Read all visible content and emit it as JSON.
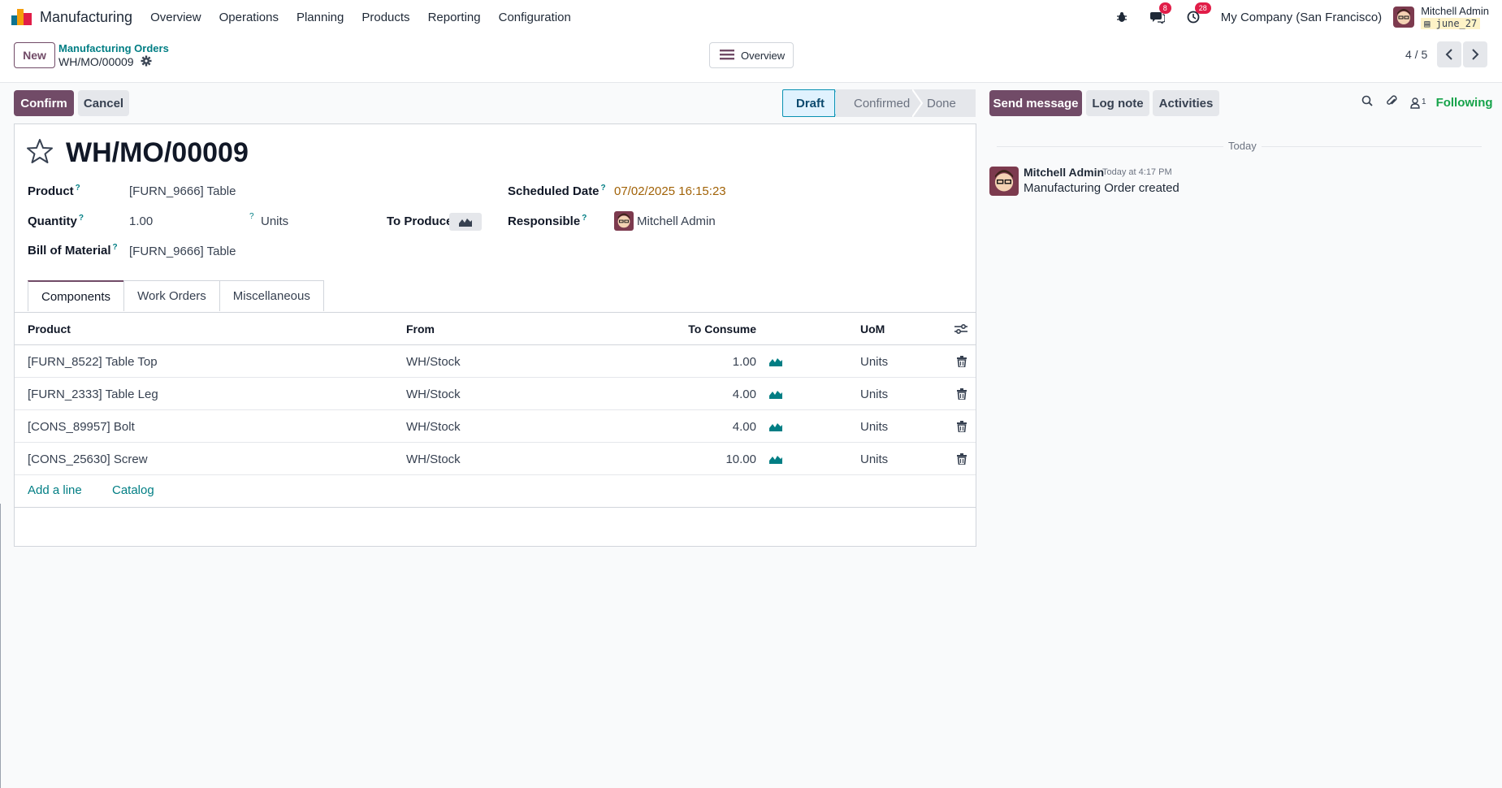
{
  "colors": {
    "primary": "#714b67",
    "link": "#017e84",
    "badge": "#e11d48",
    "following": "#16a34a"
  },
  "navbar": {
    "app_name": "Manufacturing",
    "menu": [
      "Overview",
      "Operations",
      "Planning",
      "Products",
      "Reporting",
      "Configuration"
    ],
    "icons": [
      "bug-icon",
      "chat-icon",
      "clock-icon"
    ],
    "messages_badge": "8",
    "activities_badge": "28",
    "company": "My Company (San Francisco)",
    "user_name": "Mitchell Admin",
    "database": "june_27"
  },
  "control": {
    "new_label": "New",
    "breadcrumb_parent": "Manufacturing Orders",
    "breadcrumb_current": "WH/MO/00009",
    "overview_label": "Overview",
    "pager": "4 / 5"
  },
  "actions": {
    "confirm": "Confirm",
    "cancel": "Cancel"
  },
  "status": {
    "stages": [
      "Draft",
      "Confirmed",
      "Done"
    ],
    "current": "Draft"
  },
  "form": {
    "title": "WH/MO/00009",
    "product_label": "Product",
    "product_value": "[FURN_9666] Table",
    "quantity_label": "Quantity",
    "quantity_value": "1.00",
    "uom_value": "Units",
    "to_produce_label": "To Produce",
    "bom_label": "Bill of Material",
    "bom_value": "[FURN_9666] Table",
    "scheduled_label": "Scheduled Date",
    "scheduled_value": "07/02/2025 16:15:23",
    "responsible_label": "Responsible",
    "responsible_value": "Mitchell Admin",
    "help_mark": "?"
  },
  "tabs": [
    "Components",
    "Work Orders",
    "Miscellaneous"
  ],
  "components": {
    "headers": {
      "product": "Product",
      "from": "From",
      "to_consume": "To Consume",
      "uom": "UoM"
    },
    "rows": [
      {
        "product": "[FURN_8522] Table Top",
        "from": "WH/Stock",
        "qty": "1.00",
        "uom": "Units"
      },
      {
        "product": "[FURN_2333] Table Leg",
        "from": "WH/Stock",
        "qty": "4.00",
        "uom": "Units"
      },
      {
        "product": "[CONS_89957] Bolt",
        "from": "WH/Stock",
        "qty": "4.00",
        "uom": "Units"
      },
      {
        "product": "[CONS_25630] Screw",
        "from": "WH/Stock",
        "qty": "10.00",
        "uom": "Units"
      }
    ],
    "add_line": "Add a line",
    "catalog": "Catalog"
  },
  "chatter": {
    "send_message": "Send message",
    "log_note": "Log note",
    "activities": "Activities",
    "followers_count": "1",
    "following": "Following",
    "date_separator": "Today",
    "message": {
      "author": "Mitchell Admin",
      "time": "Today at 4:17 PM",
      "body": "Manufacturing Order created"
    }
  }
}
